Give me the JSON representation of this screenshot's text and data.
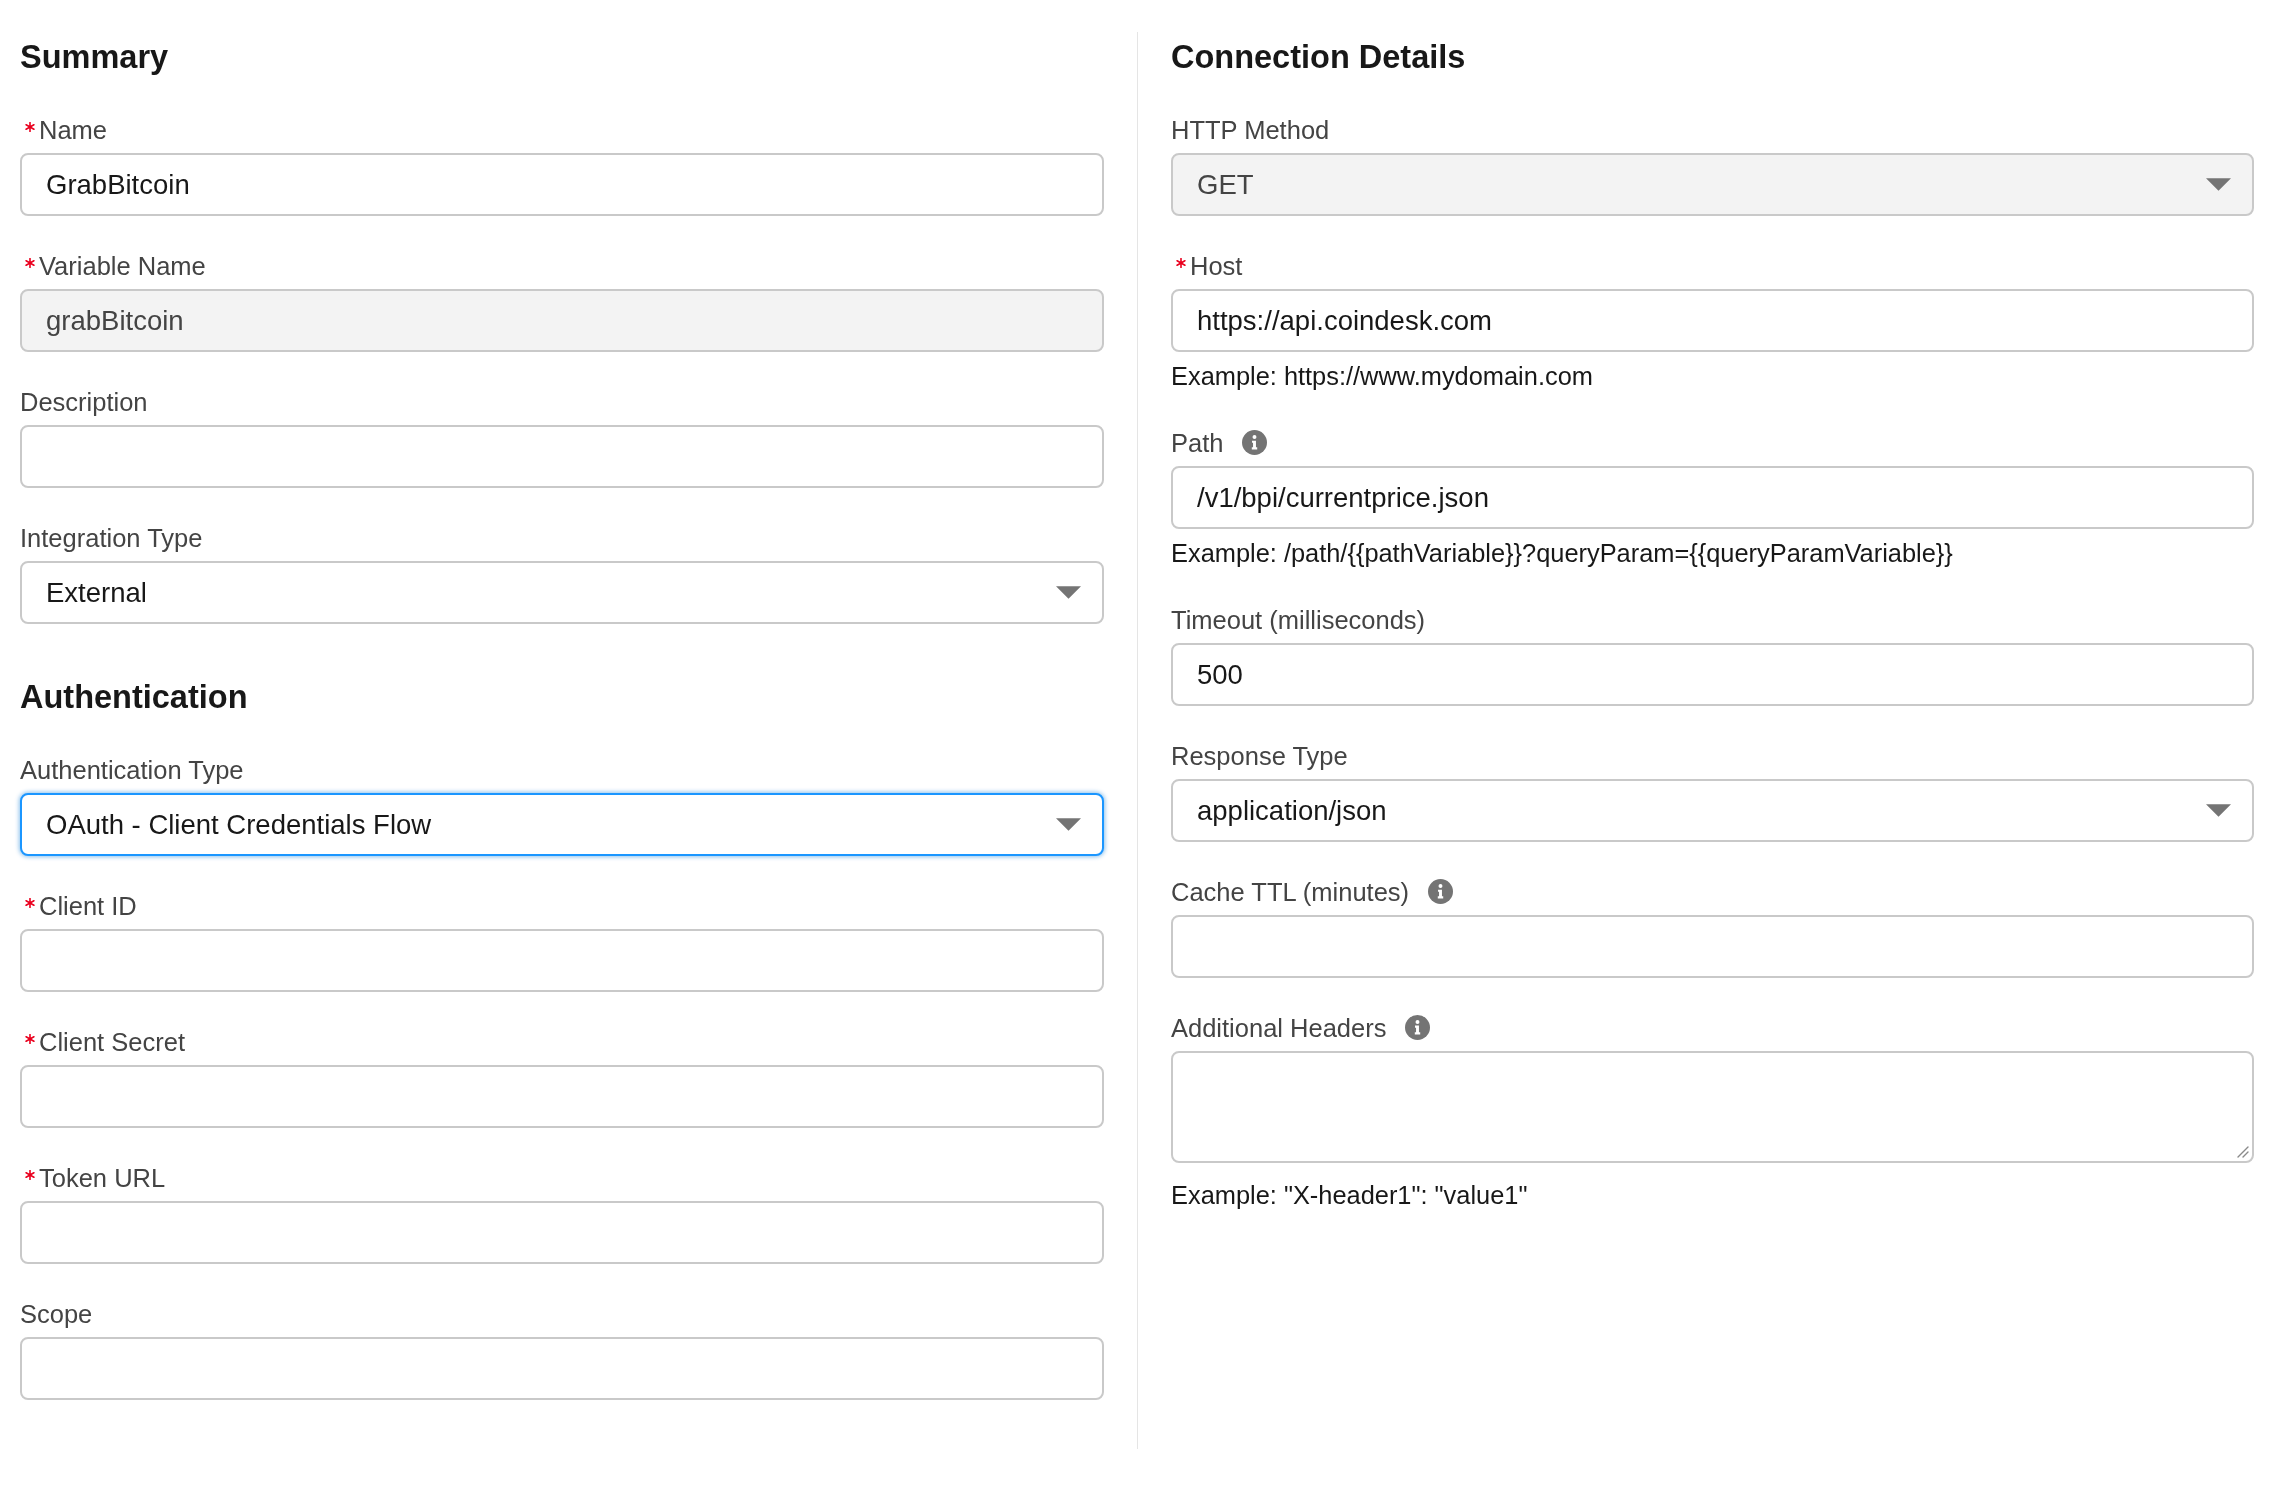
{
  "columns": [
    {
      "sections": [
        {
          "heading": "Summary",
          "fields": [
            {
              "kind": "text",
              "label": "Name",
              "required": true,
              "info": false,
              "disabled": false,
              "focused": false,
              "value": "GrabBitcoin"
            },
            {
              "kind": "text",
              "label": "Variable Name",
              "required": true,
              "info": false,
              "disabled": true,
              "focused": false,
              "value": "grabBitcoin"
            },
            {
              "kind": "text",
              "label": "Description",
              "required": false,
              "info": false,
              "disabled": false,
              "focused": false
            },
            {
              "kind": "select",
              "label": "Integration Type",
              "required": false,
              "info": false,
              "disabled": false,
              "focused": false,
              "value": "External"
            }
          ]
        },
        {
          "heading": "Authentication",
          "fields": [
            {
              "kind": "select",
              "label": "Authentication Type",
              "required": false,
              "info": false,
              "disabled": false,
              "focused": true,
              "value": "OAuth - Client Credentials Flow"
            },
            {
              "kind": "text",
              "label": "Client ID",
              "required": true,
              "info": false,
              "disabled": false,
              "focused": false
            },
            {
              "kind": "text",
              "label": "Client Secret",
              "required": true,
              "info": false,
              "disabled": false,
              "focused": false
            },
            {
              "kind": "text",
              "label": "Token URL",
              "required": true,
              "info": false,
              "disabled": false,
              "focused": false
            },
            {
              "kind": "text",
              "label": "Scope",
              "required": false,
              "info": false,
              "disabled": false,
              "focused": false
            }
          ]
        }
      ]
    },
    {
      "sections": [
        {
          "heading": "Connection Details",
          "fields": [
            {
              "kind": "select",
              "label": "HTTP Method",
              "required": false,
              "info": false,
              "disabled": true,
              "focused": false,
              "value": "GET"
            },
            {
              "kind": "text",
              "label": "Host",
              "required": true,
              "info": false,
              "disabled": false,
              "focused": false,
              "value": "https://api.coindesk.com",
              "help": "Example: https://www.mydomain.com"
            },
            {
              "kind": "text",
              "label": "Path",
              "required": false,
              "info": true,
              "disabled": false,
              "focused": false,
              "value": "/v1/bpi/currentprice.json",
              "help": "Example: /path/{{pathVariable}}?queryParam={{queryParamVariable}}"
            },
            {
              "kind": "text",
              "label": "Timeout (milliseconds)",
              "required": false,
              "info": false,
              "disabled": false,
              "focused": false,
              "value": "500"
            },
            {
              "kind": "select",
              "label": "Response Type",
              "required": false,
              "info": false,
              "disabled": false,
              "focused": false,
              "value": "application/json"
            },
            {
              "kind": "text",
              "label": "Cache TTL (minutes)",
              "required": false,
              "info": true,
              "disabled": false,
              "focused": false
            },
            {
              "kind": "textarea",
              "label": "Additional Headers",
              "required": false,
              "info": true,
              "disabled": false,
              "focused": false,
              "help": "Example: \"X-header1\": \"value1\""
            }
          ]
        }
      ]
    }
  ]
}
